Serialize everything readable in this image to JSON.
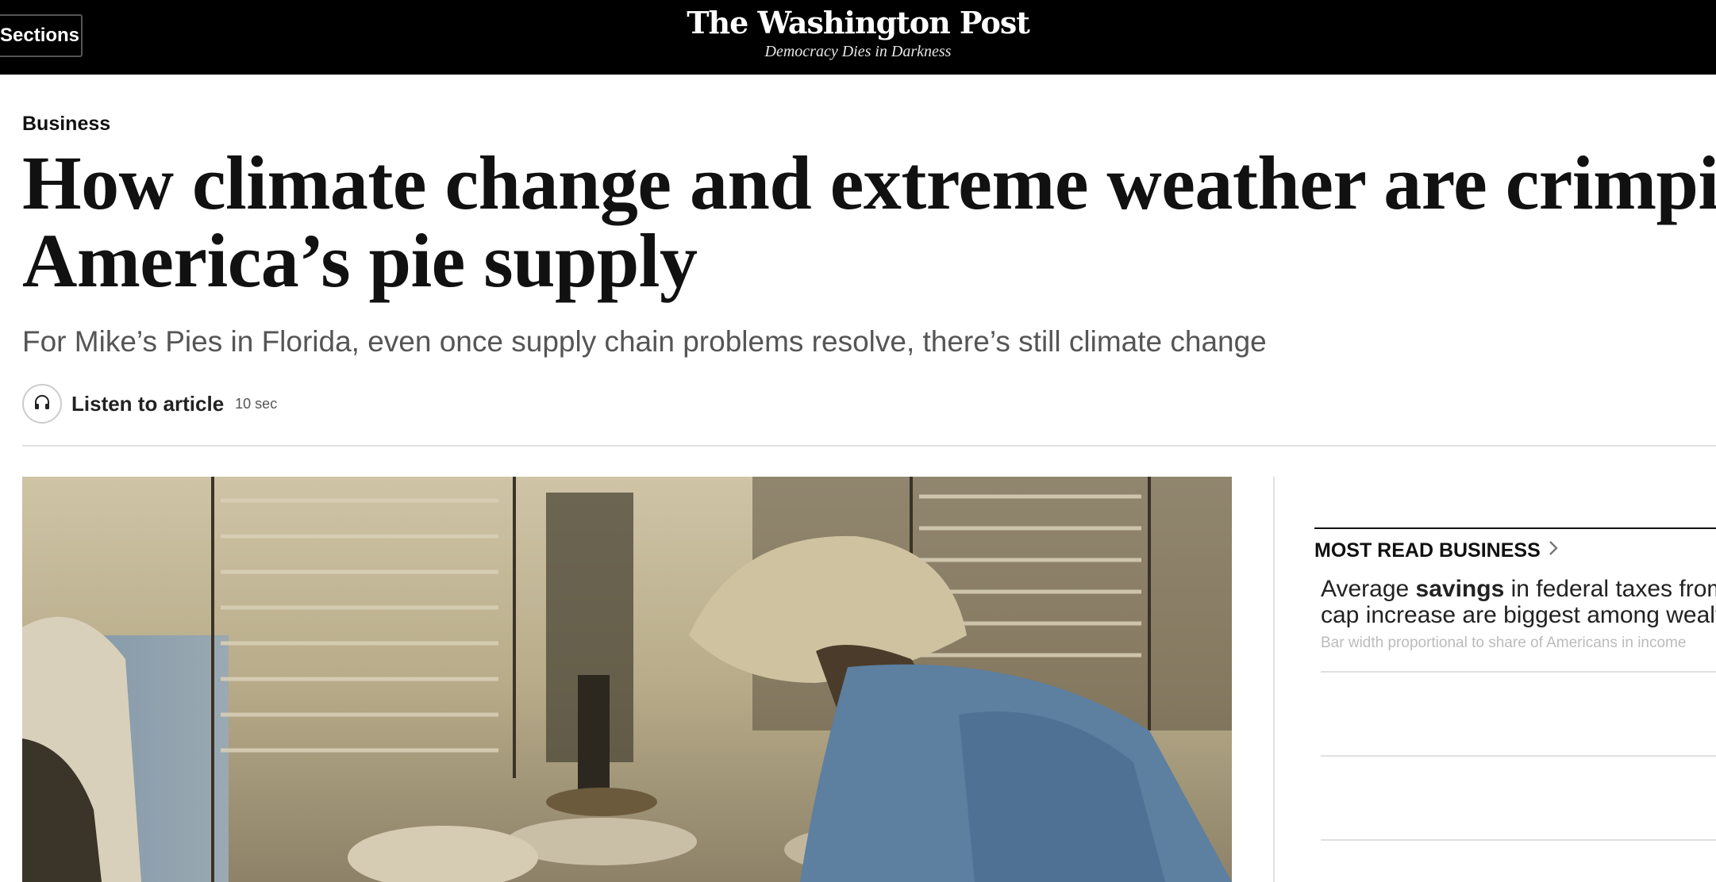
{
  "header": {
    "sections_label": "Sections",
    "logo_text": "The Washington Post",
    "tagline": "Democracy Dies in Darkness"
  },
  "article": {
    "kicker": "Business",
    "headline_line1": "How climate change and extreme weather are crimping",
    "headline_line2": "America’s pie supply",
    "dek": "For Mike’s Pies in Florida, even once supply chain problems resolve, there’s still climate change",
    "listen_label": "Listen to article",
    "listen_duration": "10 sec"
  },
  "rail": {
    "title": "MOST READ BUSINESS",
    "item1": {
      "line1_pre": "Average ",
      "line1_bold": "savings",
      "line1_post": " in federal taxes from",
      "line2": "cap increase are biggest among wealthy",
      "sub": "Bar width proportional to share of Americans in income"
    }
  },
  "icons": {
    "menu": "menu-icon",
    "headphones": "headphones-icon",
    "chevron": "chevron-right-icon"
  },
  "colors": {
    "topbar": "#000000",
    "text": "#111111",
    "dek": "#555555",
    "rule": "#e0e0e0"
  }
}
